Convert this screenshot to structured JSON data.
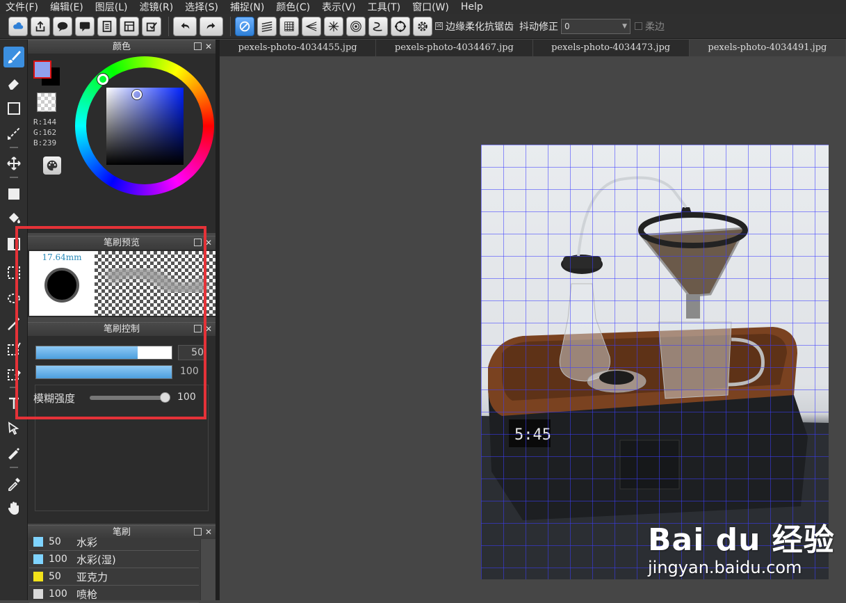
{
  "menu": [
    "文件(F)",
    "编辑(E)",
    "图层(L)",
    "滤镜(R)",
    "选择(S)",
    "捕捉(N)",
    "颜色(C)",
    "表示(V)",
    "工具(T)",
    "窗口(W)",
    "Help"
  ],
  "toolbar": {
    "antialias_label": "边缘柔化抗锯齿",
    "antialias_checked": "☒",
    "stabilizer_label": "抖动修正",
    "stabilizer_value": "0",
    "soft_edge_label": "柔边"
  },
  "panels": {
    "color_title": "颜色",
    "preview_title": "笔刷预览",
    "control_title": "笔刷控制",
    "brush_title": "笔刷"
  },
  "color": {
    "fg_hex": "#90a2ef",
    "bg_hex": "#000000",
    "r": "R:144",
    "g": "G:162",
    "b": "B:239"
  },
  "brush_preview": {
    "size": "17.64mm"
  },
  "brush_control": {
    "size_value": "50",
    "size_fraction": 0.75,
    "opacity_value": "100",
    "opacity_fraction": 1.0,
    "blur_label": "模糊强度",
    "blur_value": "100"
  },
  "brushes": [
    {
      "size": "50",
      "name": "水彩",
      "color": "#7fd4ff"
    },
    {
      "size": "100",
      "name": "水彩(湿)",
      "color": "#7fd4ff"
    },
    {
      "size": "50",
      "name": "亚克力",
      "color": "#f2e21a"
    },
    {
      "size": "100",
      "name": "喷枪",
      "color": "#d9d9d9"
    }
  ],
  "tabs": [
    "pexels-photo-4034455.jpg",
    "pexels-photo-4034467.jpg",
    "pexels-photo-4034473.jpg",
    "pexels-photo-4034491.jpg"
  ],
  "watermark": {
    "brand": "Bai du 经验",
    "url": "jingyan.baidu.com"
  },
  "accent": "#3b8fe0",
  "highlight": "#e53238"
}
